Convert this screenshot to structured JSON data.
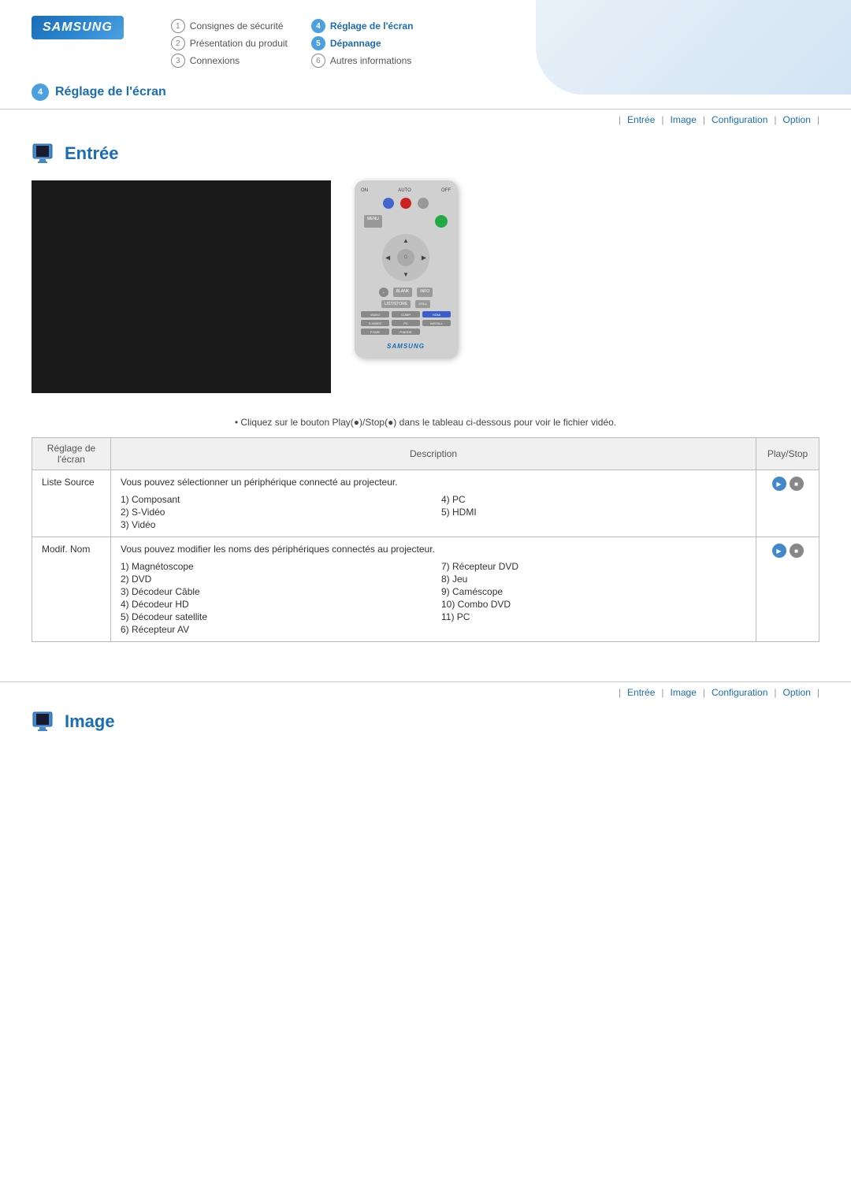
{
  "brand": "SAMSUNG",
  "header": {
    "nav_items": [
      {
        "num": "1",
        "label": "Consignes de sécurité",
        "active": false
      },
      {
        "num": "4",
        "label": "Réglage de l'écran",
        "active": true
      },
      {
        "num": "2",
        "label": "Présentation du produit",
        "active": false
      },
      {
        "num": "5",
        "label": "Dépannage",
        "active": true
      },
      {
        "num": "3",
        "label": "Connexions",
        "active": false
      },
      {
        "num": "6",
        "label": "Autres informations",
        "active": false
      }
    ],
    "page_label_num": "4",
    "page_label_text": "Réglage de l'écran"
  },
  "breadcrumb": {
    "items": [
      "Entrée",
      "Image",
      "Configuration",
      "Option"
    ],
    "separators": [
      "|",
      "|",
      "|",
      "|"
    ]
  },
  "section_entree": {
    "title": "Entrée",
    "icon": "monitor-icon"
  },
  "table_note": "• Cliquez sur le bouton Play(●)/Stop(●) dans le tableau ci-dessous pour voir le fichier vidéo.",
  "table": {
    "headers": [
      "Réglage de l'écran",
      "Description",
      "Play/Stop"
    ],
    "rows": [
      {
        "label": "Liste Source",
        "description": "Vous pouvez sélectionner un périphérique connecté au projecteur.",
        "items_col1": [
          "1) Composant",
          "2) S-Vidéo",
          "3) Vidéo"
        ],
        "items_col2": [
          "4) PC",
          "5) HDMI"
        ],
        "has_playstop": true
      },
      {
        "label": "Modif. Nom",
        "description": "Vous pouvez modifier les noms des périphériques connectés au projecteur.",
        "items_col1": [
          "1) Magnétoscope",
          "2) DVD",
          "3) Décodeur Câble",
          "4) Décodeur HD",
          "5) Décodeur satellite",
          "6) Récepteur AV"
        ],
        "items_col2": [
          "7) Récepteur DVD",
          "8) Jeu",
          "9) Caméscope",
          "10) Combo DVD",
          "11) PC"
        ],
        "has_playstop": true
      }
    ]
  },
  "bottom_breadcrumb": {
    "items": [
      "Entrée",
      "Image",
      "Configuration",
      "Option"
    ]
  },
  "section_image": {
    "title": "Image",
    "icon": "monitor-icon"
  }
}
